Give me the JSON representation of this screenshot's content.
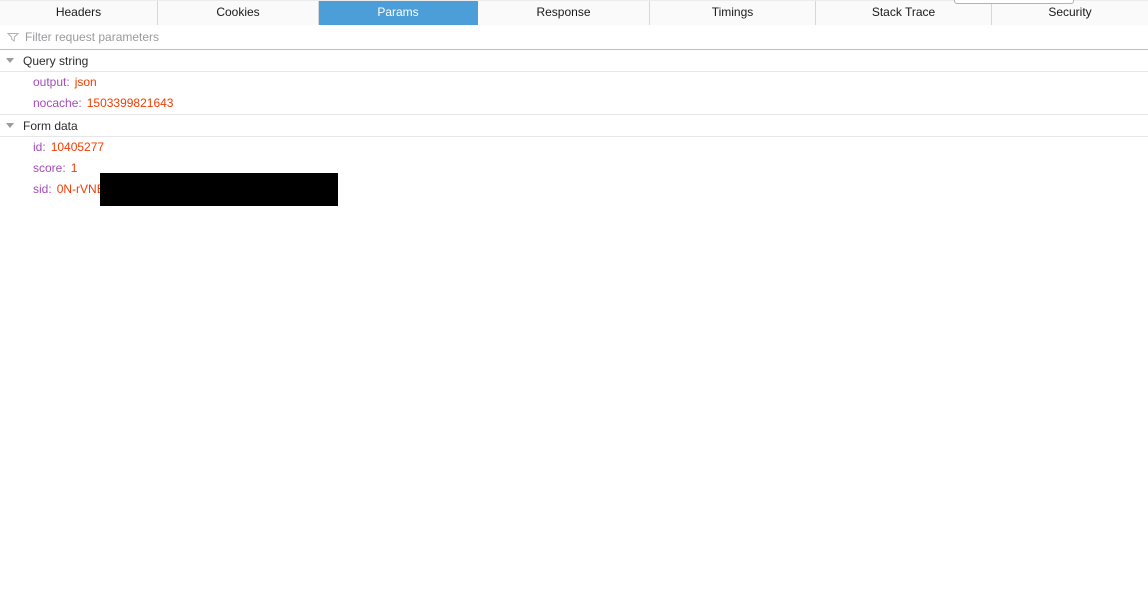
{
  "tabs": {
    "items": [
      {
        "label": "Headers",
        "selected": false
      },
      {
        "label": "Cookies",
        "selected": false
      },
      {
        "label": "Params",
        "selected": true
      },
      {
        "label": "Response",
        "selected": false
      },
      {
        "label": "Timings",
        "selected": false
      },
      {
        "label": "Stack Trace",
        "selected": false
      },
      {
        "label": "Security",
        "selected": false
      }
    ]
  },
  "filter": {
    "placeholder": "Filter request parameters",
    "icon": "funnel-icon"
  },
  "sections": [
    {
      "title": "Query string",
      "params": [
        {
          "key": "output",
          "value": "json"
        },
        {
          "key": "nocache",
          "value": "1503399821643"
        }
      ]
    },
    {
      "title": "Form data",
      "params": [
        {
          "key": "id",
          "value": "10405277"
        },
        {
          "key": "score",
          "value": "1"
        },
        {
          "key": "sid",
          "value": "0N-rVNE",
          "redacted": true
        }
      ]
    }
  ],
  "colors": {
    "selected_tab_bg": "#4c9ed9",
    "selected_tab_text": "#ffffff",
    "param_key": "#a44bbc",
    "param_value": "#f13c00",
    "redaction": "#000000"
  }
}
